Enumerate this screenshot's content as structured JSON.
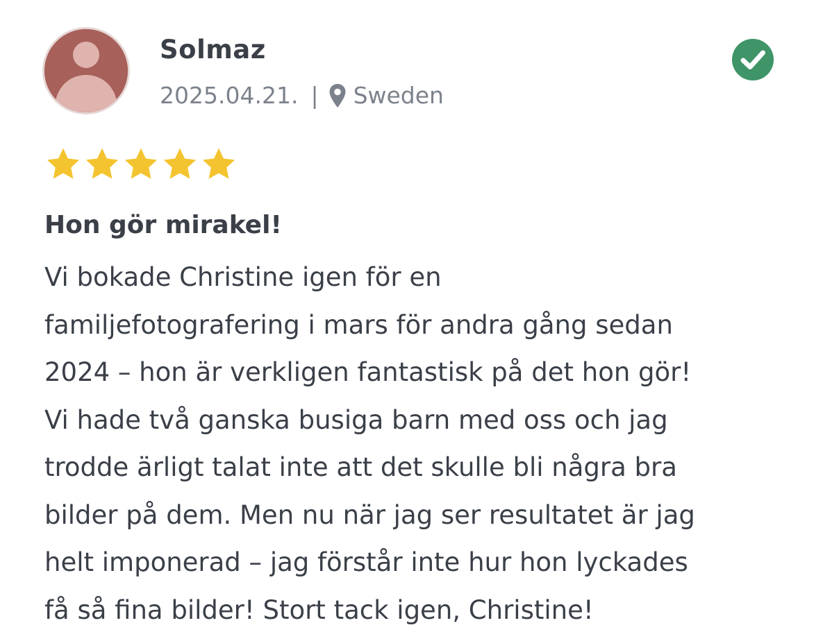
{
  "review": {
    "reviewer_name": "Solmaz",
    "date": "2025.04.21.",
    "separator": "|",
    "location": "Sweden",
    "rating": 5,
    "rating_max": 5,
    "title": "Hon gör mirakel!",
    "body_lines": [
      "Vi bokade Christine igen för en",
      "familjefotografering i mars för andra gång sedan",
      "2024 – hon är verkligen fantastisk på det hon gör!",
      "Vi hade två ganska busiga barn med oss och jag",
      "trodde ärligt talat inte att det skulle bli några bra",
      "bilder på dem. Men nu när jag ser resultatet är jag",
      "helt imponerad – jag förstår inte hur hon lyckades",
      "få så fina bilder! Stort tack igen, Christine!"
    ]
  },
  "icons": {
    "avatar": "user-silhouette-icon",
    "location": "map-pin-icon",
    "verified": "check-circle-icon",
    "star": "star-icon"
  },
  "colors": {
    "avatar_bg": "#a8605a",
    "verified": "#3f9468",
    "star": "#f4c430",
    "text": "#3a3f48",
    "meta_text": "#7c828c"
  }
}
